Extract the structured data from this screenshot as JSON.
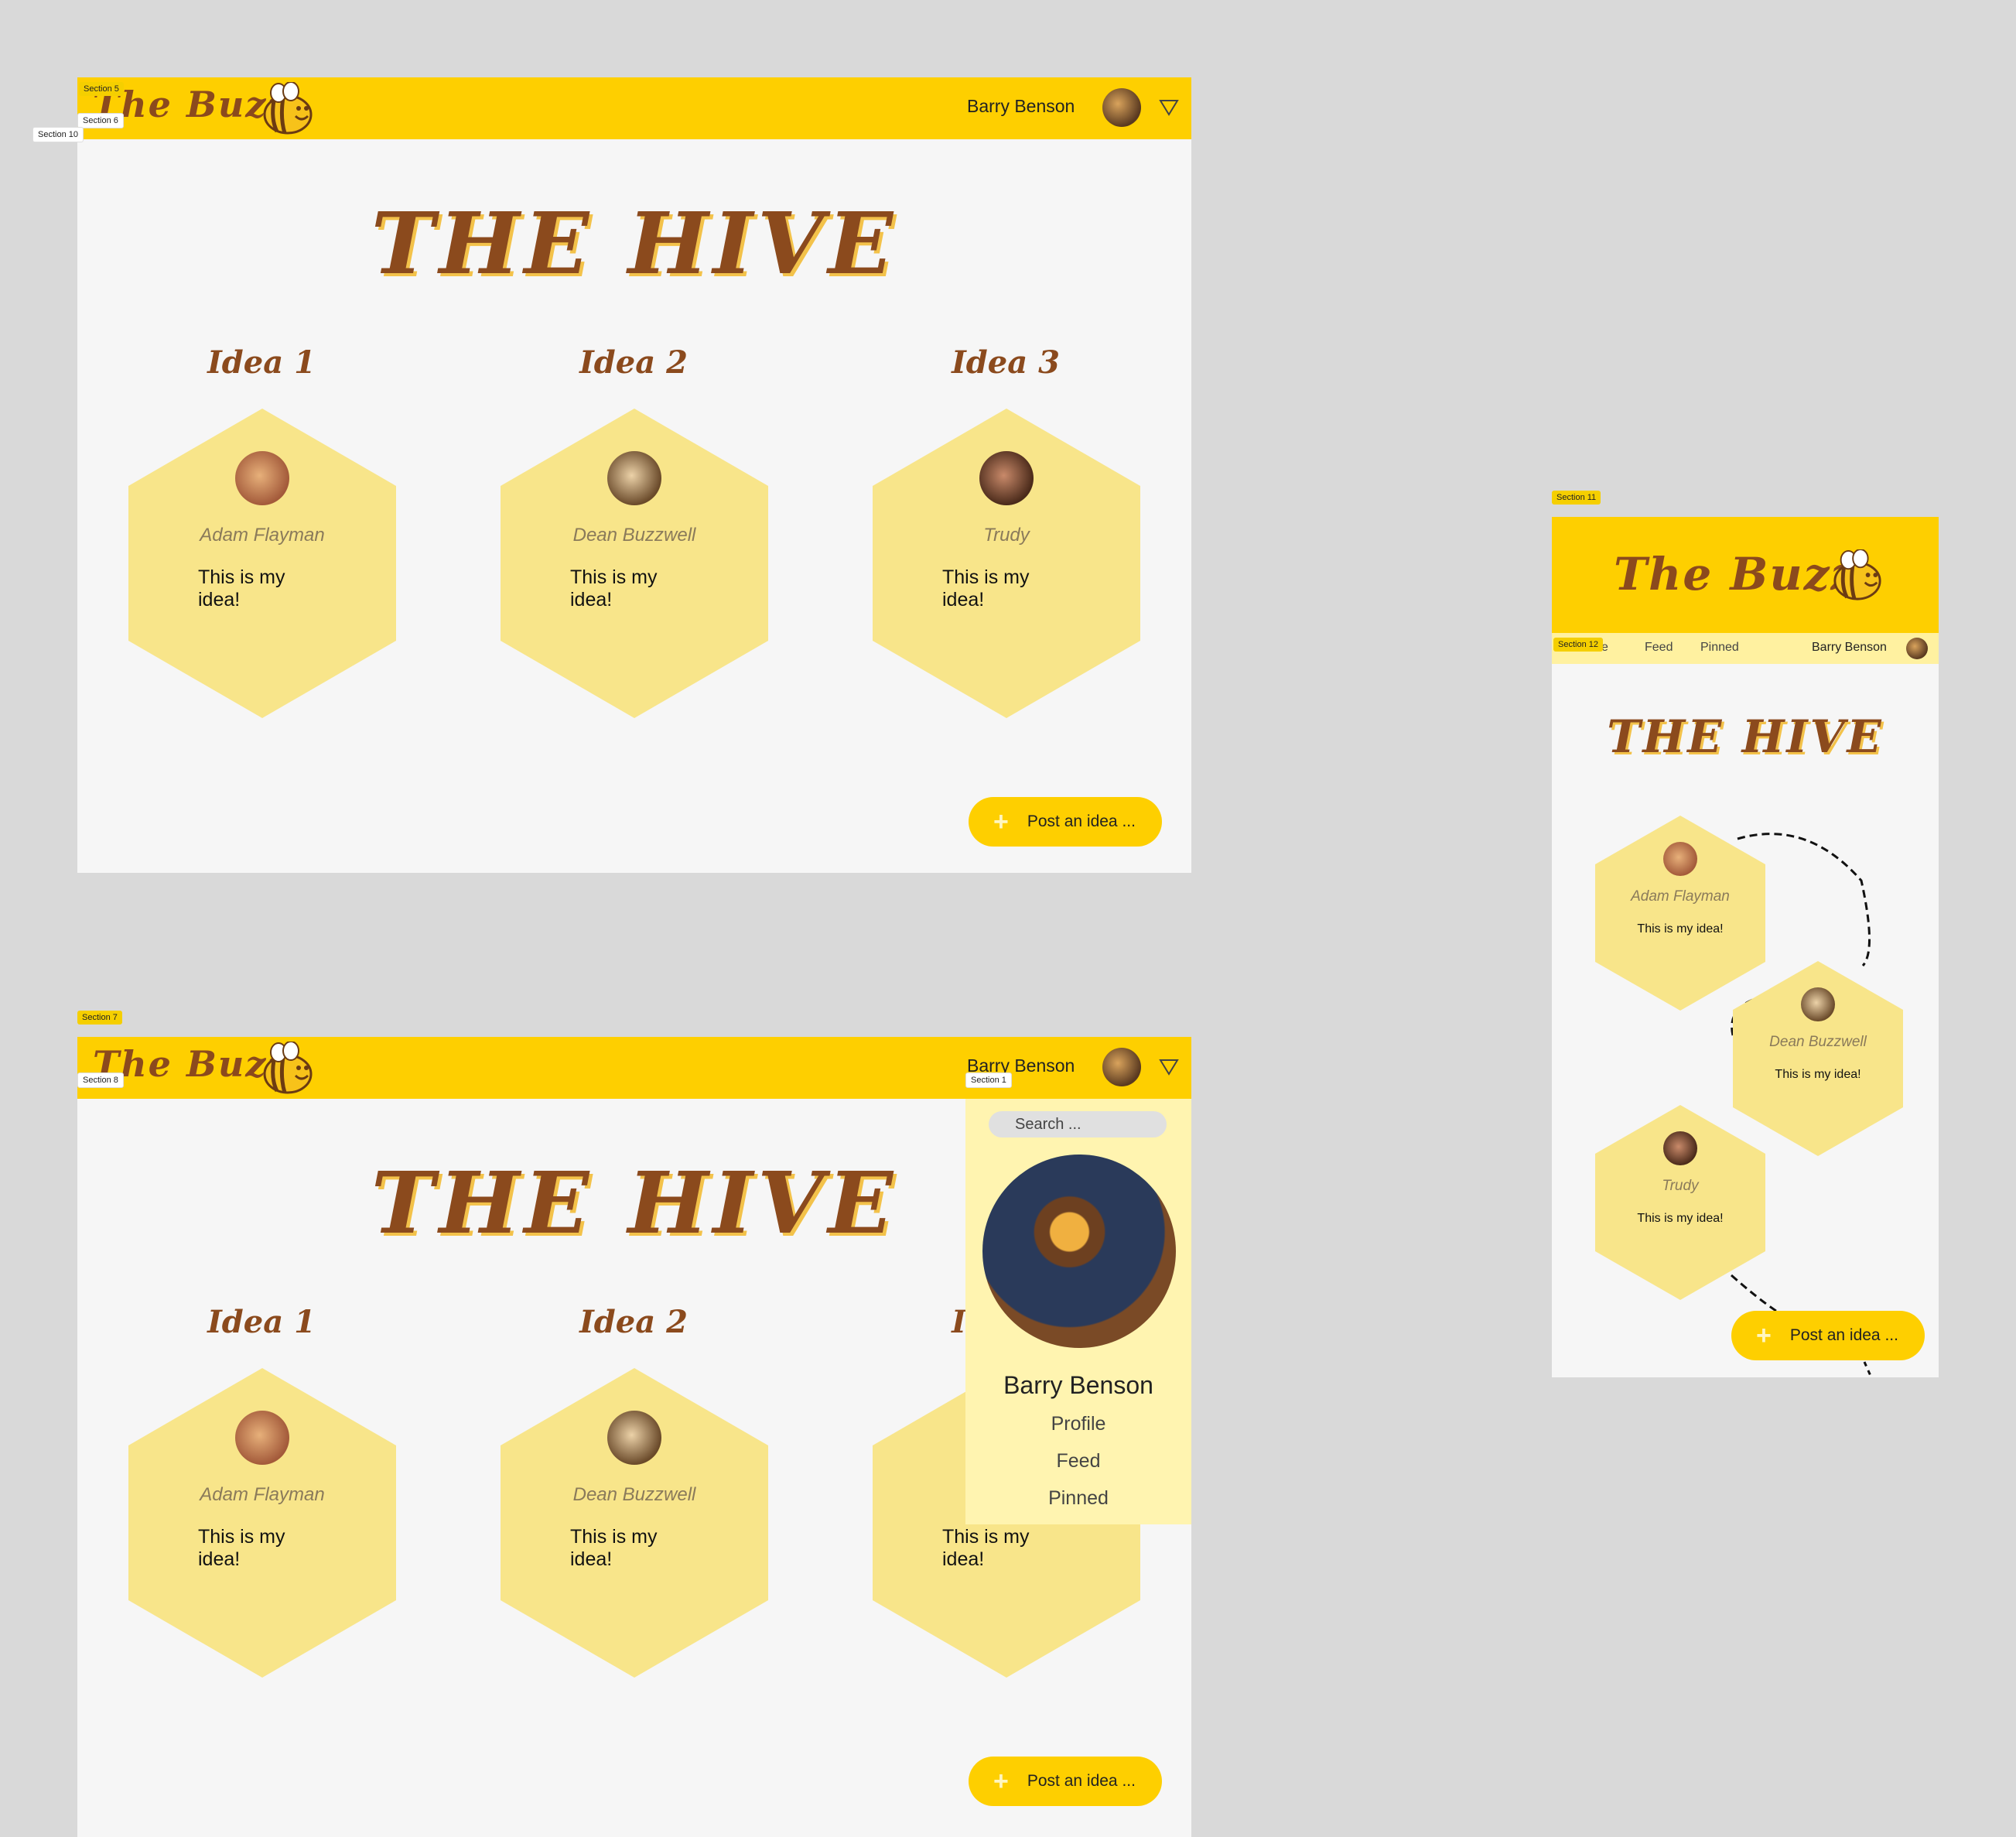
{
  "brand": {
    "name": "The Buzz"
  },
  "user": {
    "name": "Barry Benson"
  },
  "page_title": "THE HIVE",
  "ideas": [
    {
      "title": "Idea 1",
      "author": "Adam Flayman",
      "text": "This is my idea!"
    },
    {
      "title": "Idea 2",
      "author": "Dean Buzzwell",
      "text": "This is my idea!"
    },
    {
      "title": "Idea 3",
      "author": "Trudy",
      "text": "This is my idea!"
    }
  ],
  "post_button": {
    "label": "Post an idea ..."
  },
  "dropdown": {
    "search_placeholder": "Search ...",
    "items": [
      "Profile",
      "Feed",
      "Pinned"
    ]
  },
  "mobile_nav": {
    "items": [
      "e",
      "Feed",
      "Pinned"
    ]
  },
  "section_labels": {
    "s5": "Section 5",
    "s6": "Section 6",
    "s10": "Section 10",
    "s7": "Section 7",
    "s8": "Section 8",
    "s1": "Section 1",
    "s11": "Section 11",
    "s12": "Section 12"
  },
  "colors": {
    "header": "#fecf00",
    "hex": "#f8e58a",
    "title": "#8b4a1d",
    "dropdown_bg": "#fff4b0",
    "canvas": "#d9d9d9"
  },
  "icons": [
    "bee-icon",
    "dropdown-triangle-icon",
    "plus-icon",
    "avatar"
  ]
}
